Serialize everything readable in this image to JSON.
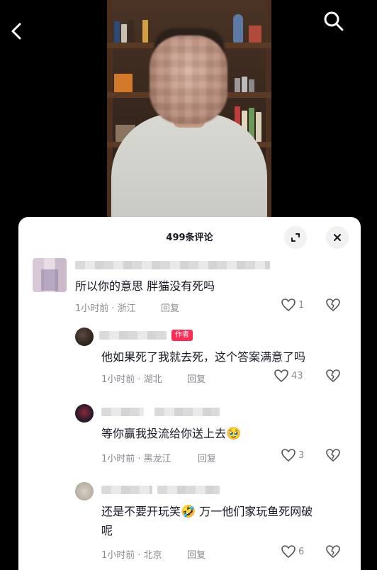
{
  "header": {
    "back_icon": "chevron-left-icon",
    "search_icon": "search-icon"
  },
  "panel": {
    "title": "499条评论",
    "expand_icon": "expand-icon",
    "close_icon": "close-icon"
  },
  "comments": [
    {
      "text": "所以你的意思 胖猫没有死吗",
      "time_location": "1小时前 · 浙江",
      "reply_label": "回复",
      "likes": "1"
    },
    {
      "badge": "作者",
      "text": "他如果死了我就去死，这个答案满意了吗",
      "time_location": "1小时前 · 湖北",
      "reply_label": "回复",
      "likes": "43"
    },
    {
      "text": "等你赢我投流给你送上去",
      "emoji": "🥹",
      "time_location": "1小时前 · 黑龙江",
      "reply_label": "回复",
      "likes": "3"
    },
    {
      "text_line1_a": "还是不要开玩笑",
      "emoji": "🤣",
      "text_line1_b": "万一他们家玩鱼死网破",
      "text_line2": "呢",
      "time_location": "1小时前 · 北京",
      "reply_label": "回复",
      "likes": "6"
    }
  ],
  "colors": {
    "accent": "#fe2c55",
    "text_primary": "#161823",
    "text_secondary": "#8a8b91",
    "panel_bg": "#ffffff",
    "page_bg": "#000000"
  }
}
